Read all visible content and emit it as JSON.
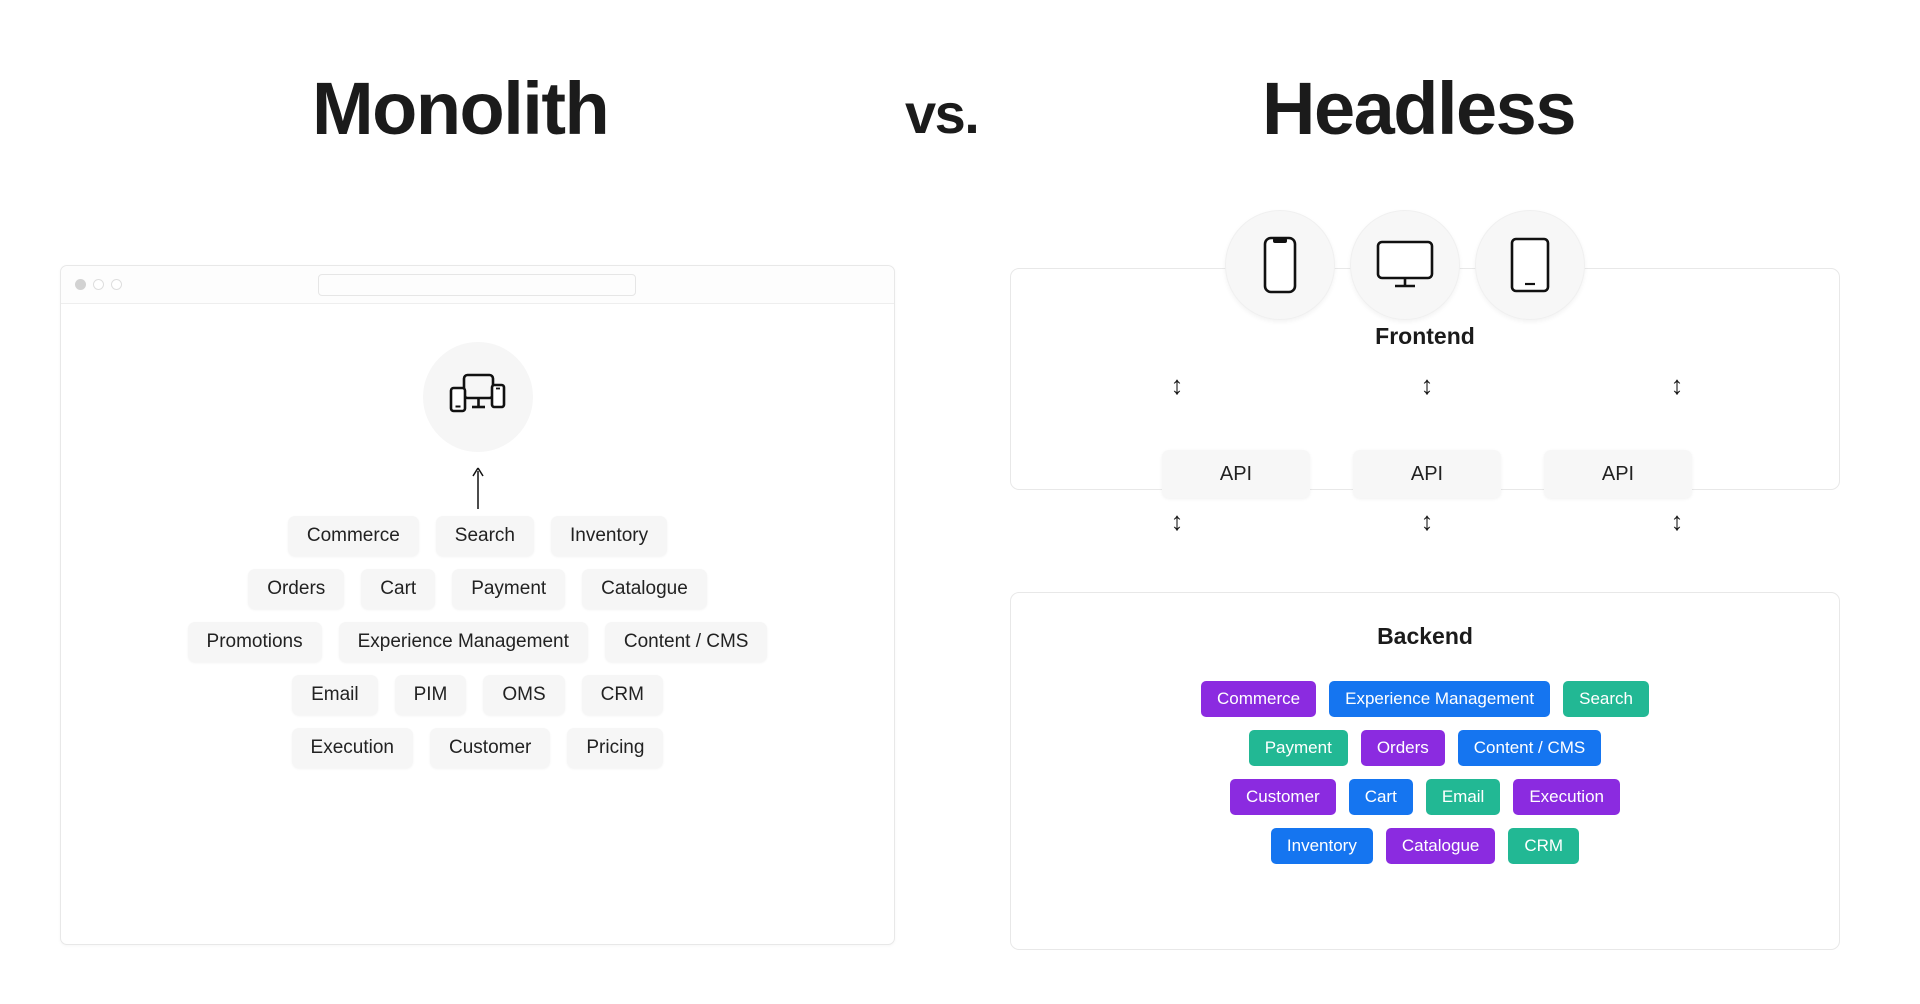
{
  "titles": {
    "left": "Monolith",
    "middle": "vs.",
    "right": "Headless"
  },
  "monolith": {
    "browser": {
      "url_placeholder": "",
      "url_value": "",
      "dots": [
        "traffic-light-close",
        "traffic-light-minimize",
        "traffic-light-maximize"
      ]
    },
    "center_icon": "multi-device-icon",
    "arrow": "↑",
    "rows": [
      [
        "Commerce",
        "Search",
        "Inventory"
      ],
      [
        "Orders",
        "Cart",
        "Payment",
        "Catalogue"
      ],
      [
        "Promotions",
        "Experience Management",
        "Content / CMS"
      ],
      [
        "Email",
        "PIM",
        "OMS",
        "CRM"
      ],
      [
        "Execution",
        "Customer",
        "Pricing"
      ]
    ]
  },
  "headless": {
    "devices": [
      "phone-icon",
      "monitor-icon",
      "tablet-icon"
    ],
    "frontend_label": "Frontend",
    "backend_label": "Backend",
    "arrow_symbol": "↕",
    "api_boxes": [
      "API",
      "API",
      "API"
    ],
    "arrows_top": [
      "↕",
      "↕",
      "↕"
    ],
    "arrows_bottom": [
      "↕",
      "↕",
      "↕"
    ],
    "backend_rows": [
      [
        {
          "label": "Commerce",
          "color": "#8B2BE0"
        },
        {
          "label": "Experience Management",
          "color": "#1575F0"
        },
        {
          "label": "Search",
          "color": "#22B894"
        }
      ],
      [
        {
          "label": "Payment",
          "color": "#22B894"
        },
        {
          "label": "Orders",
          "color": "#8B2BE0"
        },
        {
          "label": "Content / CMS",
          "color": "#1575F0"
        }
      ],
      [
        {
          "label": "Customer",
          "color": "#8B2BE0"
        },
        {
          "label": "Cart",
          "color": "#1575F0"
        },
        {
          "label": "Email",
          "color": "#22B894"
        },
        {
          "label": "Execution",
          "color": "#8B2BE0"
        }
      ],
      [
        {
          "label": "Inventory",
          "color": "#1575F0"
        },
        {
          "label": "Catalogue",
          "color": "#8B2BE0"
        },
        {
          "label": "CRM",
          "color": "#22B894"
        }
      ]
    ]
  },
  "colors": {
    "purple": "#8B2BE0",
    "blue": "#1575F0",
    "teal": "#22B894",
    "tag_gray": "#f6f6f6",
    "text_dark": "#1b1b1b"
  }
}
